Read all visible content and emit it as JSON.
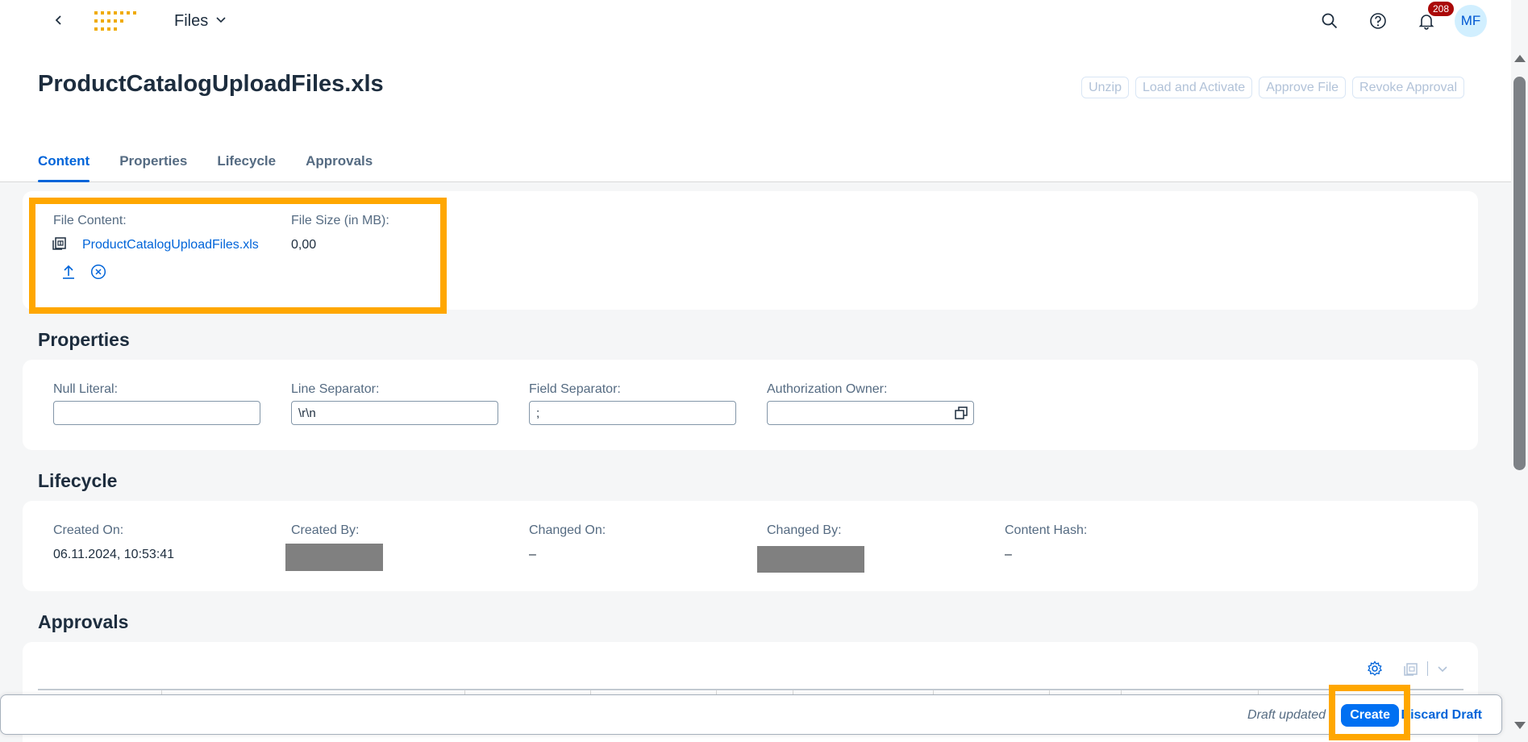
{
  "shell": {
    "app_title": "Files",
    "notification_count": "208",
    "avatar_initials": "MF"
  },
  "header": {
    "title": "ProductCatalogUploadFiles.xls",
    "actions": [
      "Unzip",
      "Load and Activate",
      "Approve File",
      "Revoke Approval"
    ],
    "tabs": [
      "Content",
      "Properties",
      "Lifecycle",
      "Approvals"
    ],
    "active_tab": "Content"
  },
  "content": {
    "file_content_label": "File Content:",
    "file_name": "ProductCatalogUploadFiles.xls",
    "file_size_label": "File Size (in MB):",
    "file_size": "0,00"
  },
  "properties": {
    "title": "Properties",
    "null_literal_label": "Null Literal:",
    "null_literal_value": "",
    "line_separator_label": "Line Separator:",
    "line_separator_value": "\\r\\n",
    "field_separator_label": "Field Separator:",
    "field_separator_value": ";",
    "auth_owner_label": "Authorization Owner:",
    "auth_owner_value": ""
  },
  "lifecycle": {
    "title": "Lifecycle",
    "created_on_label": "Created On:",
    "created_on": "06.11.2024, 10:53:41",
    "created_by_label": "Created By:",
    "changed_on_label": "Changed On:",
    "changed_on": "–",
    "changed_by_label": "Changed By:",
    "content_hash_label": "Content Hash:",
    "content_hash": "–"
  },
  "approvals": {
    "title": "Approvals"
  },
  "footer": {
    "draft_status": "Draft updated",
    "create_label": "Create",
    "discard_label": "Discard Draft"
  },
  "colors": {
    "highlight": "#ffa700",
    "brand_blue": "#0070f2",
    "link_blue": "#0064d9",
    "badge_red": "#aa0808"
  },
  "icons": [
    "back-icon",
    "company-logo",
    "chevron-down-icon",
    "search-icon",
    "help-icon",
    "bell-icon",
    "file-icon",
    "upload-icon",
    "clear-icon",
    "value-help-icon",
    "settings-icon",
    "copy-icon"
  ]
}
